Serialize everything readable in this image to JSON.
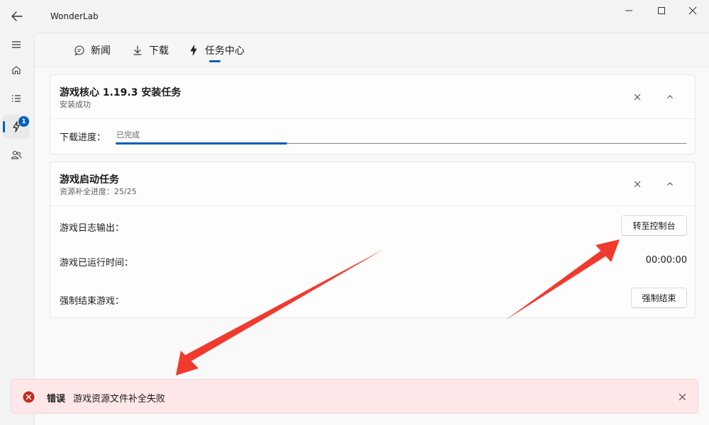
{
  "window": {
    "title": "WonderLab"
  },
  "nav": {
    "task_badge": "1"
  },
  "tabs": [
    {
      "label": "新闻",
      "icon": "chat-icon"
    },
    {
      "label": "下载",
      "icon": "download-icon"
    },
    {
      "label": "任务中心",
      "icon": "lightning-icon",
      "selected": true
    }
  ],
  "install_task": {
    "title": "游戏核心 1.19.3 安装任务",
    "subtitle": "安装成功",
    "progress_label": "下载进度：",
    "progress_status": "已完成",
    "progress_value": 0.3
  },
  "launch_task": {
    "title": "游戏启动任务",
    "subtitle": "资源补全进度：25/25",
    "log_label": "游戏日志输出：",
    "console_button": "转至控制台",
    "runtime_label": "游戏已运行时间：",
    "runtime_value": "00:00:00",
    "kill_label": "强制结束游戏：",
    "kill_button": "强制结束"
  },
  "toast": {
    "title": "错误",
    "message": "游戏资源文件补全失败"
  },
  "colors": {
    "accent": "#005fb8",
    "error_bg": "#fde7e9",
    "error_icon": "#c42b1c",
    "annotation_arrow": "#f03a2e"
  }
}
